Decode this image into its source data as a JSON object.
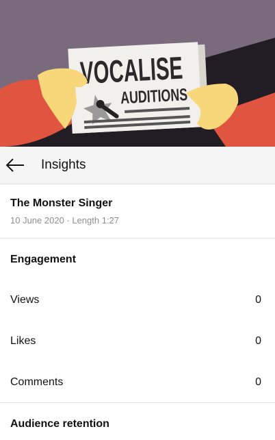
{
  "hero": {
    "headline": "VOCALISE",
    "subheadline": "AUDITIONS",
    "colors": {
      "background_top": "#7b6c7d",
      "background_bottom": "#1f1a22",
      "sleeve": "#e0553f",
      "hand": "#f7d779",
      "paper": "#f2f0ec"
    }
  },
  "appbar": {
    "back_icon": "arrow-left-icon",
    "title": "Insights"
  },
  "video": {
    "title": "The Monster Singer",
    "meta": "10 June 2020 · Length 1:27"
  },
  "engagement": {
    "title": "Engagement",
    "rows": [
      {
        "label": "Views",
        "value": "0"
      },
      {
        "label": "Likes",
        "value": "0"
      },
      {
        "label": "Comments",
        "value": "0"
      }
    ]
  },
  "retention": {
    "title": "Audience retention"
  }
}
